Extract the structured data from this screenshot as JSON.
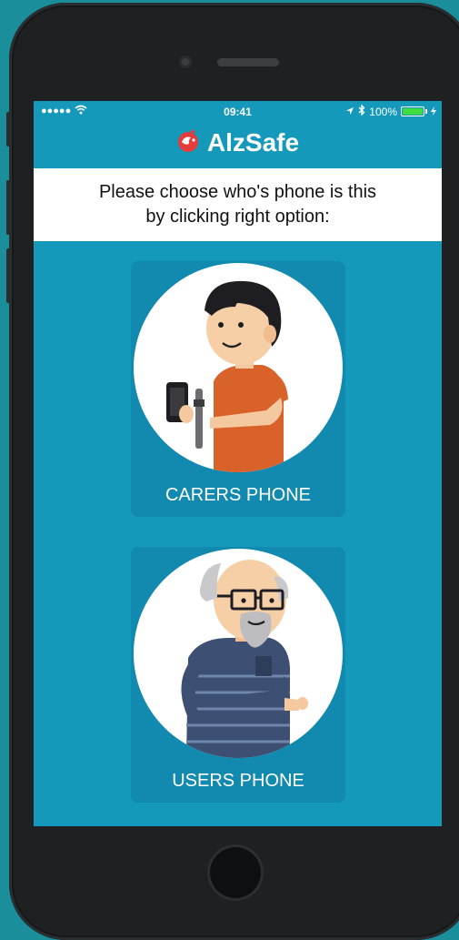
{
  "status_bar": {
    "signal": "●●●●●",
    "time": "09:41",
    "battery_percent": "100%",
    "battery_level": 1.0
  },
  "header": {
    "app_name": "AlzSafe"
  },
  "prompt": {
    "line1": "Please choose who's phone is this",
    "line2": "by clicking right option:"
  },
  "options": [
    {
      "label": "CARERS PHONE",
      "icon": "carer-avatar"
    },
    {
      "label": "USERS PHONE",
      "icon": "elderly-user-avatar"
    }
  ],
  "colors": {
    "background": "#1b8e9c",
    "screen": "#1599bb",
    "card": "#1289ae",
    "brand_red": "#e63b3b"
  }
}
